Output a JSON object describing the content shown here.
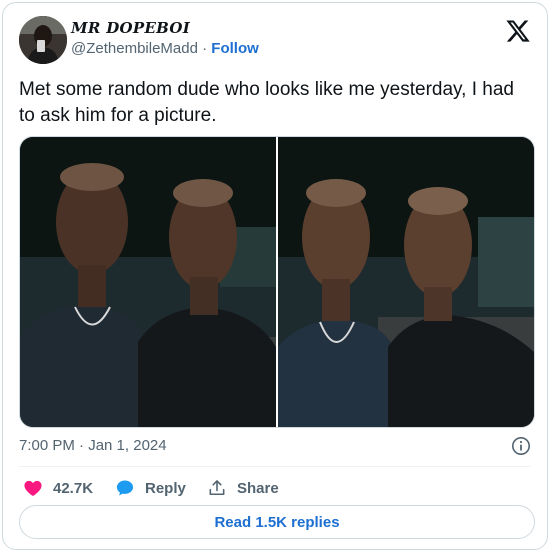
{
  "author": {
    "display_name": "MR DOPEBOI",
    "handle": "@ZethembileMadd",
    "separator": "·",
    "follow_label": "Follow"
  },
  "tweet": {
    "text": "Met some random dude who looks like me yesterday, I had to ask him for a picture.",
    "timestamp": "7:00 PM · Jan 1, 2024"
  },
  "actions": {
    "like_count": "42.7K",
    "reply_label": "Reply",
    "share_label": "Share"
  },
  "replies_button": "Read 1.5K replies",
  "icons": [
    "x-logo-icon",
    "heart-icon",
    "reply-icon",
    "share-icon",
    "info-icon"
  ],
  "colors": {
    "link_blue": "#1d6fd1",
    "like_pink": "#f91880",
    "reply_blue": "#1d9bf0",
    "muted_gray": "#536471",
    "border": "#cfd9de"
  }
}
